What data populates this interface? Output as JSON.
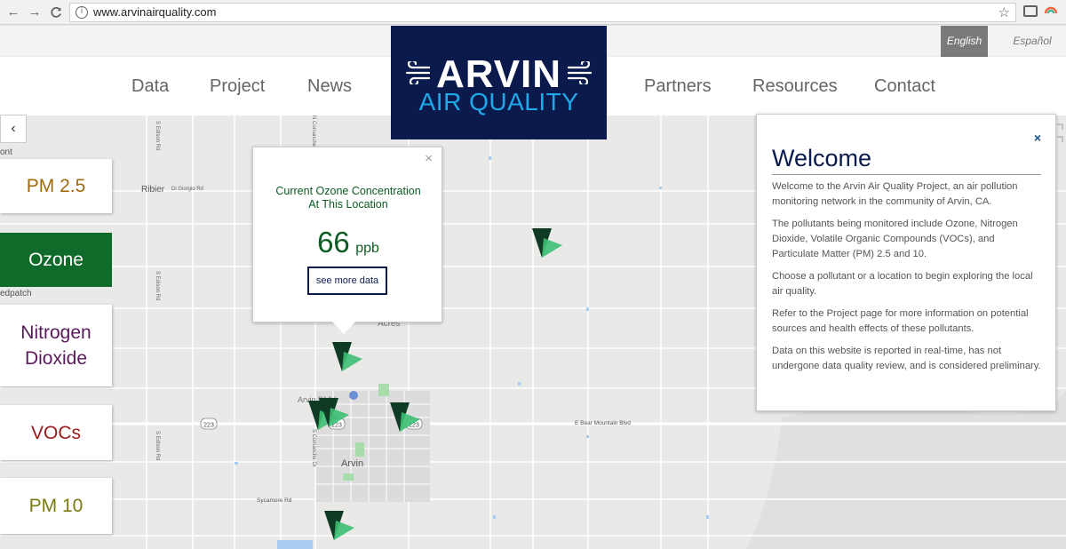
{
  "browser": {
    "url": "www.arvinairquality.com",
    "info_glyph": "i",
    "back_glyph": "←",
    "forward_glyph": "→",
    "reload_glyph": "C",
    "star_glyph": "☆"
  },
  "lang": {
    "active": "English",
    "other": "Español"
  },
  "nav": {
    "data": "Data",
    "project": "Project",
    "news": "News",
    "partners": "Partners",
    "resources": "Resources",
    "contact": "Contact"
  },
  "logo": {
    "line1": "ARVIN",
    "line2": "AIR QUALITY"
  },
  "sidebar": {
    "collapse_glyph": "‹",
    "items": [
      {
        "label_lines": [
          "PM 2.5"
        ],
        "color": "#a06a10"
      },
      {
        "label_lines": [
          "Ozone"
        ],
        "color": "#ffffff"
      },
      {
        "label_lines": [
          "Nitrogen",
          "Dioxide"
        ],
        "color": "#5a1a5a"
      },
      {
        "label_lines": [
          "VOCs"
        ],
        "color": "#9a1a1a"
      },
      {
        "label_lines": [
          "PM 10"
        ],
        "color": "#7a7a10"
      }
    ]
  },
  "popup": {
    "close_glyph": "×",
    "title_lines": [
      "Current Ozone Concentration",
      "At This Location"
    ],
    "value": "66",
    "unit": "ppb",
    "button": "see more data"
  },
  "welcome": {
    "close_glyph": "×",
    "title": "Welcome",
    "paragraphs": [
      "Welcome to the Arvin Air Quality Project, an air pollution monitoring network in the community of Arvin, CA.",
      "The pollutants being monitored include Ozone, Nitrogen Dioxide, Volatile Organic Compounds (VOCs), and Particulate Matter (PM) 2.5 and 10.",
      "Choose a pollutant or a location to begin exploring the local air quality.",
      "Refer to the Project page for more information on potential sources and health effects of these pollutants.",
      "Data on this website is reported in real-time, has not undergone data quality review, and is considered preliminary."
    ]
  },
  "map": {
    "labels": {
      "ribier": "Ribier",
      "di_giorgio": "Di Giorgio Rd",
      "arvin": "Arvin",
      "aries": "Acres",
      "arvin_dmv": "Arvin DMV",
      "e_bear": "E Bear Mountain Blvd",
      "sycamore": "Sycamore Rd",
      "s_edison_1": "S Edison Rd",
      "s_edison_2": "S Edison Rd",
      "s_comanche": "S Comanche Dr",
      "n_comanche": "N Comanche",
      "edpatch": "edpatch",
      "ont": "ont",
      "hwy_223_a": "223",
      "hwy_223_b": "223",
      "hwy_223_c": "223"
    },
    "marker_colors": {
      "dark": "#0f3b25",
      "light": "#3dbf73"
    }
  }
}
